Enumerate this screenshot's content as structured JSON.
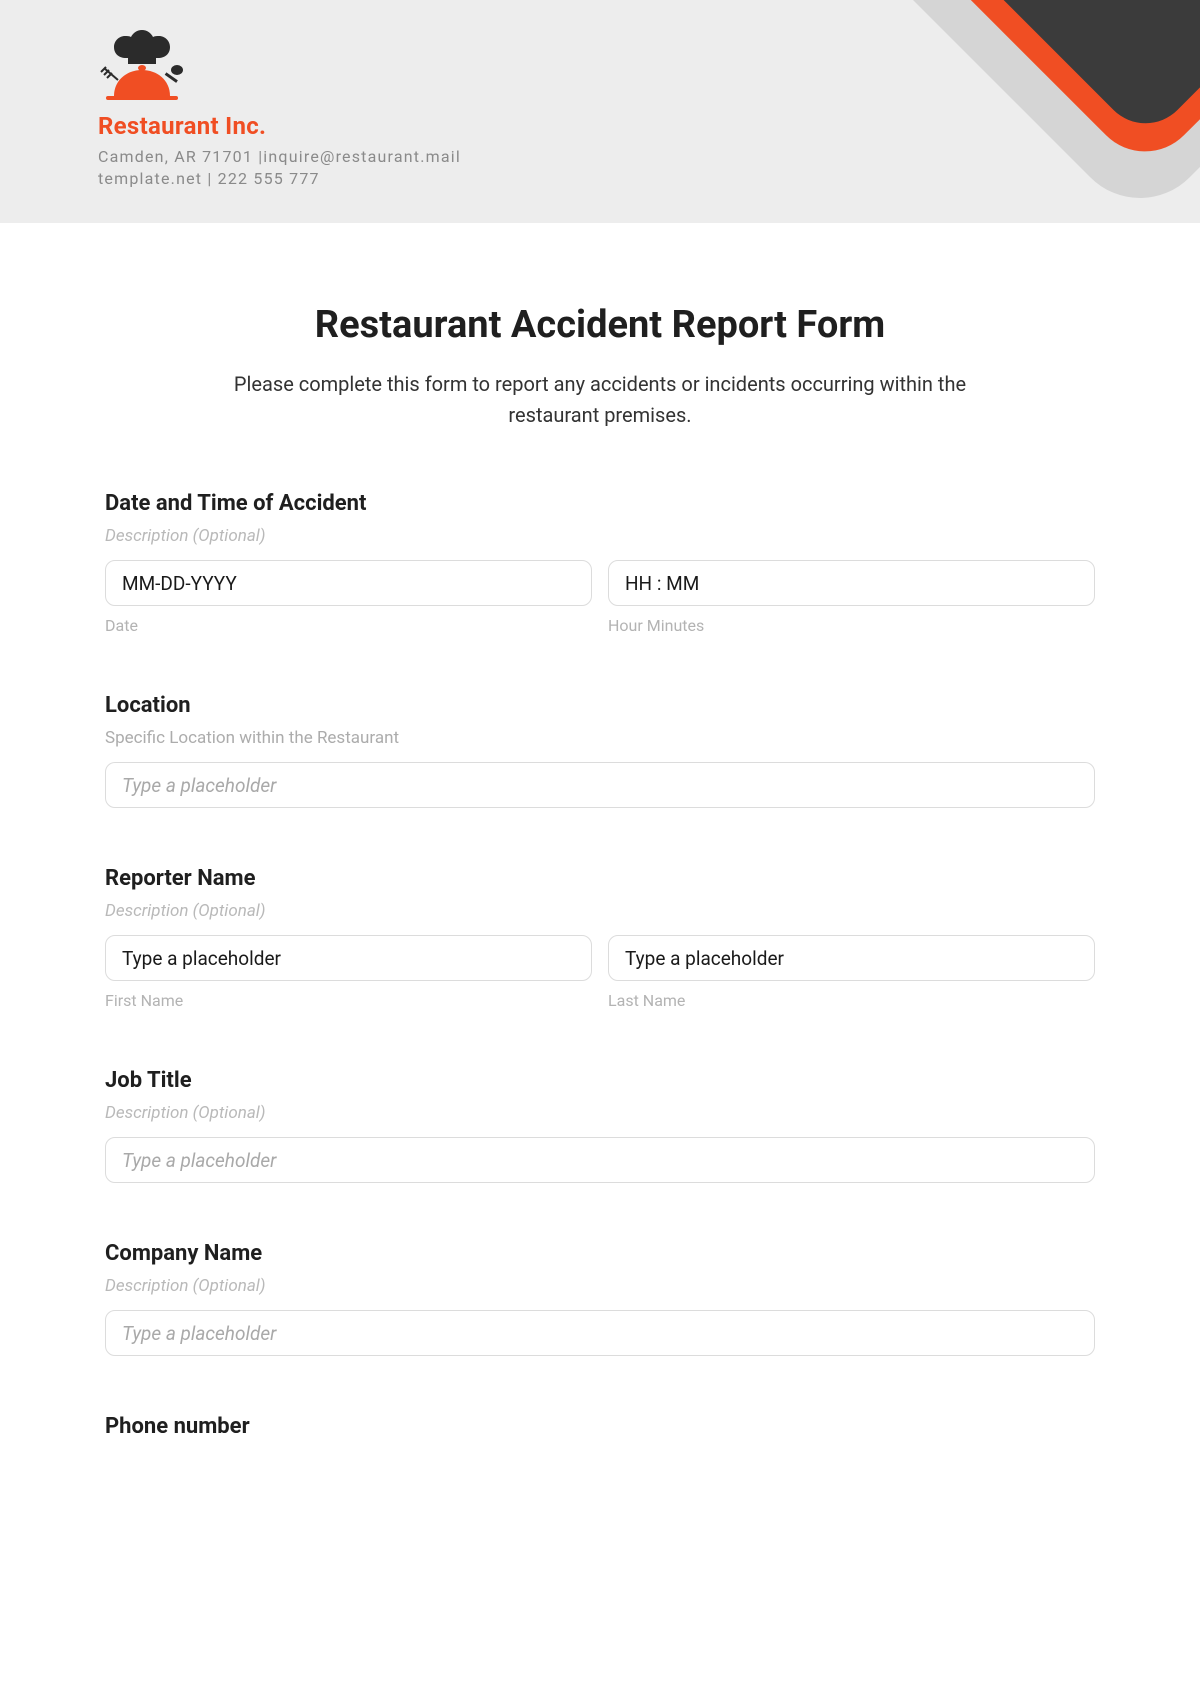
{
  "header": {
    "company_name": "Restaurant Inc.",
    "address_line": "Camden, AR 71701 |inquire@restaurant.mail",
    "contact_line": "template.net | 222 555 777"
  },
  "form": {
    "title": "Restaurant Accident Report Form",
    "intro": "Please complete this form to report any accidents or incidents occurring within the restaurant premises."
  },
  "sections": {
    "datetime": {
      "label": "Date and Time of Accident",
      "desc": "Description (Optional)",
      "date_placeholder": "MM-DD-YYYY",
      "date_sub": "Date",
      "time_placeholder": "HH : MM",
      "time_sub": "Hour Minutes"
    },
    "location": {
      "label": "Location",
      "desc": "Specific Location within the Restaurant",
      "placeholder": "Type a placeholder"
    },
    "reporter": {
      "label": "Reporter Name",
      "desc": "Description (Optional)",
      "first_placeholder": "Type a placeholder",
      "first_sub": "First Name",
      "last_placeholder": "Type a placeholder",
      "last_sub": "Last Name"
    },
    "jobtitle": {
      "label": "Job Title",
      "desc": "Description (Optional)",
      "placeholder": "Type a placeholder"
    },
    "company": {
      "label": "Company Name",
      "desc": "Description (Optional)",
      "placeholder": "Type a placeholder"
    },
    "phone": {
      "label": "Phone number"
    }
  }
}
